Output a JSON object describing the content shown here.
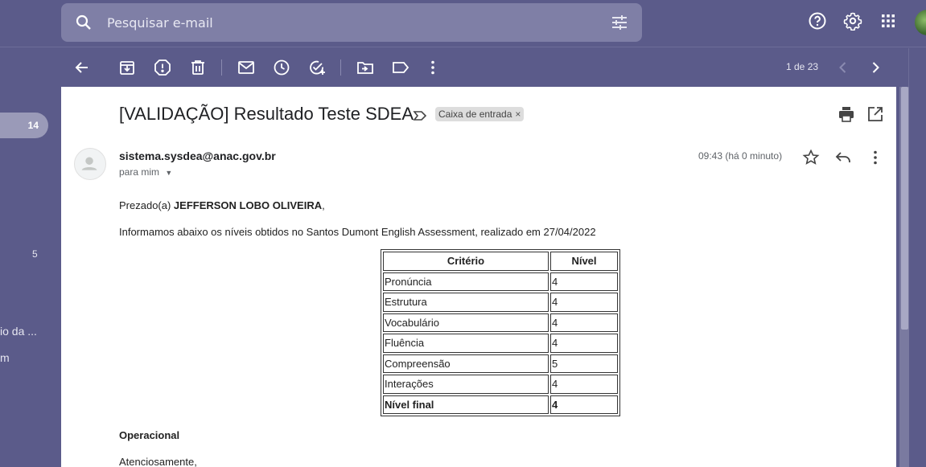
{
  "search": {
    "placeholder": "Pesquisar e-mail"
  },
  "nav": {
    "inbox_count": "14",
    "count2": "5",
    "item_a": "io da ...",
    "item_b": "m"
  },
  "pager": {
    "label": "1 de 23"
  },
  "message": {
    "subject": "[VALIDAÇÃO] Resultado Teste SDEA",
    "label": "Caixa de entrada",
    "label_close": "×",
    "sender": "sistema.sysdea@anac.gov.br",
    "to": "para mim",
    "time": "09:43 (há 0 minuto)",
    "greeting_prefix": "Prezado(a) ",
    "greeting_name": "JEFFERSON LOBO OLIVEIRA",
    "greeting_suffix": ",",
    "intro": "Informamos abaixo os níveis obtidos no Santos Dumont English Assessment, realizado em 27/04/2022",
    "status": "Operacional",
    "closing": "Atenciosamente,"
  },
  "results": {
    "headers": [
      "Critério",
      "Nível"
    ],
    "rows": [
      [
        "Pronúncia",
        "4"
      ],
      [
        "Estrutura",
        "4"
      ],
      [
        "Vocabulário",
        "4"
      ],
      [
        "Fluência",
        "4"
      ],
      [
        "Compreensão",
        "5"
      ],
      [
        "Interações",
        "4"
      ]
    ],
    "final": [
      "Nível final",
      "4"
    ]
  },
  "icons": {
    "search": "search-icon",
    "tune": "tune-icon",
    "help": "help-icon",
    "settings": "gear-icon",
    "apps": "apps-icon",
    "back": "arrow-back-icon",
    "archive": "archive-icon",
    "spam": "report-spam-icon",
    "delete": "trash-icon",
    "unread": "mark-unread-icon",
    "snooze": "snooze-icon",
    "task": "add-task-icon",
    "move": "move-to-icon",
    "labels": "label-icon",
    "more": "more-vert-icon",
    "prev": "chevron-left-icon",
    "next": "chevron-right-icon",
    "print": "print-icon",
    "open": "open-new-window-icon",
    "star": "star-icon",
    "reply": "reply-icon"
  },
  "colors": {
    "background": "#5b5b8a",
    "search_bg": "#7f7fa6",
    "pane": "#ffffff"
  }
}
